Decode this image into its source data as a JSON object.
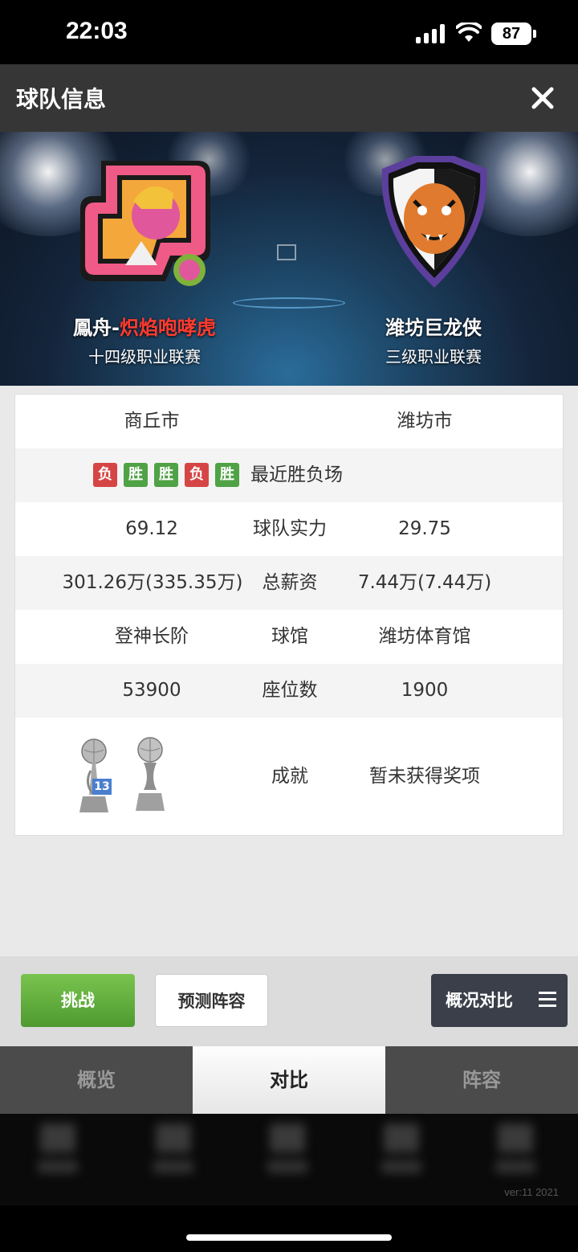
{
  "status_bar": {
    "time": "22:03",
    "battery": "87"
  },
  "header": {
    "title": "球队信息",
    "close_icon": "close-icon"
  },
  "banner": {
    "team_left": {
      "name_prefix": "鳳舟-",
      "name_highlight": "炽焰咆哮虎",
      "league": "十四级职业联赛"
    },
    "team_right": {
      "name": "潍坊巨龙侠",
      "league": "三级职业联赛"
    }
  },
  "info": {
    "city_left": "商丘市",
    "city_right": "潍坊市",
    "recent_results": [
      "负",
      "胜",
      "胜",
      "负",
      "胜"
    ],
    "recent_label": "最近胜负场",
    "strength": {
      "label": "球队实力",
      "left": "69.12",
      "right": "29.75"
    },
    "salary": {
      "label": "总薪资",
      "left": "301.26万(335.35万)",
      "right": "7.44万(7.44万)"
    },
    "arena": {
      "label": "球馆",
      "left": "登神长阶",
      "right": "潍坊体育馆"
    },
    "seats": {
      "label": "座位数",
      "left": "53900",
      "right": "1900"
    },
    "achievement": {
      "label": "成就",
      "left_trophy_count": "13",
      "right": "暂未获得奖项"
    }
  },
  "actions": {
    "challenge": "挑战",
    "predict": "预测阵容",
    "compare": "概况对比"
  },
  "tabs": [
    "概览",
    "对比",
    "阵容"
  ],
  "active_tab": 1,
  "version": "ver:11  2021",
  "colors": {
    "win": "#4fa245",
    "loss": "#d64545",
    "highlight": "#ff3b2f"
  }
}
